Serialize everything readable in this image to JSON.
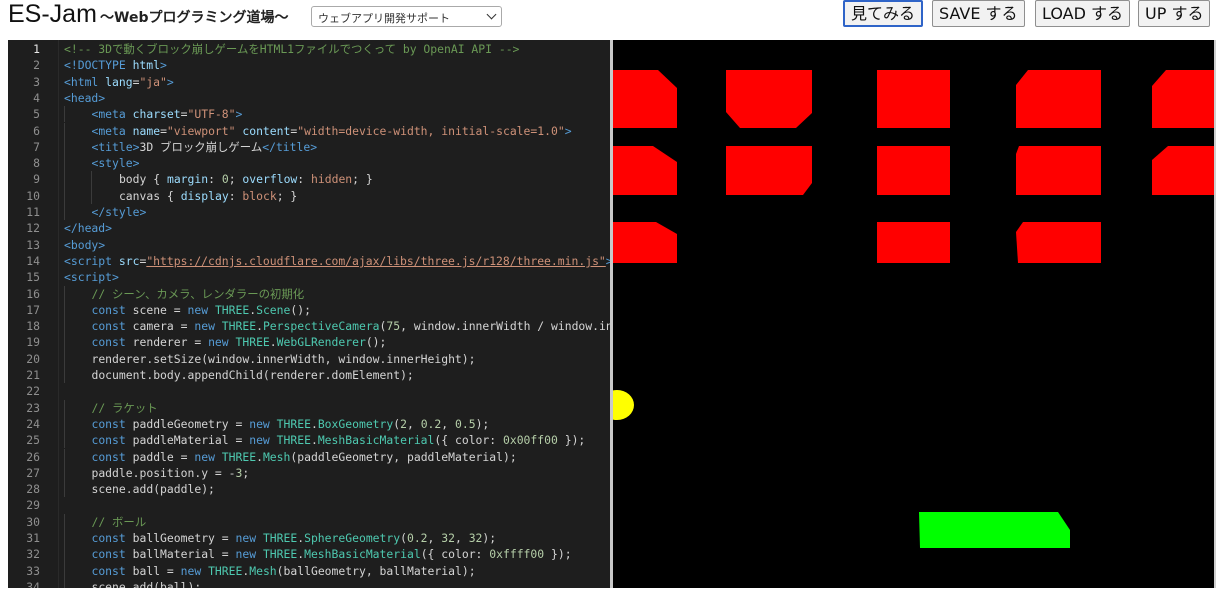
{
  "header": {
    "brand": "ES-Jam",
    "tagline": "〜Webプログラミング道場〜",
    "select_value": "ウェブアプリ開発サポート",
    "buttons": {
      "view": "見てみる",
      "save": "SAVE する",
      "load": "LOAD する",
      "up": "UP する"
    }
  },
  "editor": {
    "lines": [
      {
        "n": "1",
        "tokens": [
          [
            "com",
            "<!-- 3Dで動くブロック崩しゲームをHTML1ファイルでつくって by OpenAI API -->"
          ]
        ]
      },
      {
        "n": "2",
        "tokens": [
          [
            "tag",
            "<!DOCTYPE "
          ],
          [
            "attr",
            "html"
          ],
          [
            "tag",
            ">"
          ]
        ]
      },
      {
        "n": "3",
        "tokens": [
          [
            "tag",
            "<html "
          ],
          [
            "attr",
            "lang"
          ],
          [
            "prop",
            "="
          ],
          [
            "str",
            "\"ja\""
          ],
          [
            "tag",
            ">"
          ]
        ]
      },
      {
        "n": "4",
        "tokens": [
          [
            "tag",
            "<head>"
          ]
        ]
      },
      {
        "n": "5",
        "indent": 1,
        "tokens": [
          [
            "tag",
            "<meta "
          ],
          [
            "attr",
            "charset"
          ],
          [
            "prop",
            "="
          ],
          [
            "str",
            "\"UTF-8\""
          ],
          [
            "tag",
            ">"
          ]
        ]
      },
      {
        "n": "6",
        "indent": 1,
        "tokens": [
          [
            "tag",
            "<meta "
          ],
          [
            "attr",
            "name"
          ],
          [
            "prop",
            "="
          ],
          [
            "str",
            "\"viewport\" "
          ],
          [
            "attr",
            "content"
          ],
          [
            "prop",
            "="
          ],
          [
            "str",
            "\"width=device-width, initial-scale=1.0\""
          ],
          [
            "tag",
            ">"
          ]
        ]
      },
      {
        "n": "7",
        "indent": 1,
        "tokens": [
          [
            "tag",
            "<title>"
          ],
          [
            "prop",
            "3D ブロック崩しゲーム"
          ],
          [
            "tag",
            "</title>"
          ]
        ]
      },
      {
        "n": "8",
        "indent": 1,
        "tokens": [
          [
            "tag",
            "<style>"
          ]
        ]
      },
      {
        "n": "9",
        "indent": 2,
        "tokens": [
          [
            "prop",
            "body { "
          ],
          [
            "attr",
            "margin"
          ],
          [
            "prop",
            ": "
          ],
          [
            "num",
            "0"
          ],
          [
            "prop",
            "; "
          ],
          [
            "attr",
            "overflow"
          ],
          [
            "prop",
            ": "
          ],
          [
            "str",
            "hidden"
          ],
          [
            "prop",
            "; }"
          ]
        ]
      },
      {
        "n": "10",
        "indent": 2,
        "tokens": [
          [
            "prop",
            "canvas { "
          ],
          [
            "attr",
            "display"
          ],
          [
            "prop",
            ": "
          ],
          [
            "str",
            "block"
          ],
          [
            "prop",
            "; }"
          ]
        ]
      },
      {
        "n": "11",
        "indent": 1,
        "tokens": [
          [
            "tag",
            "</style>"
          ]
        ]
      },
      {
        "n": "12",
        "tokens": [
          [
            "tag",
            "</head>"
          ]
        ]
      },
      {
        "n": "13",
        "tokens": [
          [
            "tag",
            "<body>"
          ]
        ]
      },
      {
        "n": "14",
        "tokens": [
          [
            "tag",
            "<script "
          ],
          [
            "attr",
            "src"
          ],
          [
            "prop",
            "="
          ],
          [
            "url",
            "\"https://cdnjs.cloudflare.com/ajax/libs/three.js/r128/three.min.js\""
          ],
          [
            "tag",
            "></sc"
          ]
        ]
      },
      {
        "n": "15",
        "tokens": [
          [
            "tag",
            "<script>"
          ]
        ]
      },
      {
        "n": "16",
        "indent": 1,
        "tokens": [
          [
            "com",
            "// シーン、カメラ、レンダラーの初期化"
          ]
        ]
      },
      {
        "n": "17",
        "indent": 1,
        "tokens": [
          [
            "kw",
            "const "
          ],
          [
            "prop",
            "scene = "
          ],
          [
            "kw",
            "new "
          ],
          [
            "cls",
            "THREE"
          ],
          [
            "prop",
            "."
          ],
          [
            "cls",
            "Scene"
          ],
          [
            "prop",
            "();"
          ]
        ]
      },
      {
        "n": "18",
        "indent": 1,
        "tokens": [
          [
            "kw",
            "const "
          ],
          [
            "prop",
            "camera = "
          ],
          [
            "kw",
            "new "
          ],
          [
            "cls",
            "THREE"
          ],
          [
            "prop",
            "."
          ],
          [
            "cls",
            "PerspectiveCamera"
          ],
          [
            "prop",
            "("
          ],
          [
            "num",
            "75"
          ],
          [
            "prop",
            ", window.innerWidth / window.innerH"
          ]
        ]
      },
      {
        "n": "19",
        "indent": 1,
        "tokens": [
          [
            "kw",
            "const "
          ],
          [
            "prop",
            "renderer = "
          ],
          [
            "kw",
            "new "
          ],
          [
            "cls",
            "THREE"
          ],
          [
            "prop",
            "."
          ],
          [
            "cls",
            "WebGLRenderer"
          ],
          [
            "prop",
            "();"
          ]
        ]
      },
      {
        "n": "20",
        "indent": 1,
        "tokens": [
          [
            "prop",
            "renderer.setSize(window.innerWidth, window.innerHeight);"
          ]
        ]
      },
      {
        "n": "21",
        "indent": 1,
        "tokens": [
          [
            "prop",
            "document.body.appendChild(renderer.domElement);"
          ]
        ]
      },
      {
        "n": "22",
        "tokens": []
      },
      {
        "n": "23",
        "indent": 1,
        "tokens": [
          [
            "com",
            "// ラケット"
          ]
        ]
      },
      {
        "n": "24",
        "indent": 1,
        "tokens": [
          [
            "kw",
            "const "
          ],
          [
            "prop",
            "paddleGeometry = "
          ],
          [
            "kw",
            "new "
          ],
          [
            "cls",
            "THREE"
          ],
          [
            "prop",
            "."
          ],
          [
            "cls",
            "BoxGeometry"
          ],
          [
            "prop",
            "("
          ],
          [
            "num",
            "2"
          ],
          [
            "prop",
            ", "
          ],
          [
            "num",
            "0.2"
          ],
          [
            "prop",
            ", "
          ],
          [
            "num",
            "0.5"
          ],
          [
            "prop",
            ");"
          ]
        ]
      },
      {
        "n": "25",
        "indent": 1,
        "tokens": [
          [
            "kw",
            "const "
          ],
          [
            "prop",
            "paddleMaterial = "
          ],
          [
            "kw",
            "new "
          ],
          [
            "cls",
            "THREE"
          ],
          [
            "prop",
            "."
          ],
          [
            "cls",
            "MeshBasicMaterial"
          ],
          [
            "prop",
            "({ color: "
          ],
          [
            "num",
            "0x00ff00"
          ],
          [
            "prop",
            " });"
          ]
        ]
      },
      {
        "n": "26",
        "indent": 1,
        "tokens": [
          [
            "kw",
            "const "
          ],
          [
            "prop",
            "paddle = "
          ],
          [
            "kw",
            "new "
          ],
          [
            "cls",
            "THREE"
          ],
          [
            "prop",
            "."
          ],
          [
            "cls",
            "Mesh"
          ],
          [
            "prop",
            "(paddleGeometry, paddleMaterial);"
          ]
        ]
      },
      {
        "n": "27",
        "indent": 1,
        "tokens": [
          [
            "prop",
            "paddle.position.y = -"
          ],
          [
            "num",
            "3"
          ],
          [
            "prop",
            ";"
          ]
        ]
      },
      {
        "n": "28",
        "indent": 1,
        "tokens": [
          [
            "prop",
            "scene.add(paddle);"
          ]
        ]
      },
      {
        "n": "29",
        "tokens": []
      },
      {
        "n": "30",
        "indent": 1,
        "tokens": [
          [
            "com",
            "// ボール"
          ]
        ]
      },
      {
        "n": "31",
        "indent": 1,
        "tokens": [
          [
            "kw",
            "const "
          ],
          [
            "prop",
            "ballGeometry = "
          ],
          [
            "kw",
            "new "
          ],
          [
            "cls",
            "THREE"
          ],
          [
            "prop",
            "."
          ],
          [
            "cls",
            "SphereGeometry"
          ],
          [
            "prop",
            "("
          ],
          [
            "num",
            "0.2"
          ],
          [
            "prop",
            ", "
          ],
          [
            "num",
            "32"
          ],
          [
            "prop",
            ", "
          ],
          [
            "num",
            "32"
          ],
          [
            "prop",
            ");"
          ]
        ]
      },
      {
        "n": "32",
        "indent": 1,
        "tokens": [
          [
            "kw",
            "const "
          ],
          [
            "prop",
            "ballMaterial = "
          ],
          [
            "kw",
            "new "
          ],
          [
            "cls",
            "THREE"
          ],
          [
            "prop",
            "."
          ],
          [
            "cls",
            "MeshBasicMaterial"
          ],
          [
            "prop",
            "({ color: "
          ],
          [
            "num",
            "0xffff00"
          ],
          [
            "prop",
            " });"
          ]
        ]
      },
      {
        "n": "33",
        "indent": 1,
        "tokens": [
          [
            "kw",
            "const "
          ],
          [
            "prop",
            "ball = "
          ],
          [
            "kw",
            "new "
          ],
          [
            "cls",
            "THREE"
          ],
          [
            "prop",
            "."
          ],
          [
            "cls",
            "Mesh"
          ],
          [
            "prop",
            "(ballGeometry, ballMaterial);"
          ]
        ]
      },
      {
        "n": "34",
        "indent": 1,
        "tokens": [
          [
            "prop",
            "scene.add(ball);"
          ]
        ]
      }
    ]
  },
  "game": {
    "background": "#000000",
    "brick_color": "#ff0000",
    "paddle_color": "#00ff00",
    "ball_color": "#ffff00",
    "brick_rows": [
      [
        "left-edge",
        "block",
        "block",
        "block",
        "right-edge"
      ],
      [
        "left-edge",
        "block",
        "block",
        "block",
        "right-edge"
      ],
      [
        "left-edge",
        "",
        "block",
        "block",
        ""
      ]
    ]
  }
}
